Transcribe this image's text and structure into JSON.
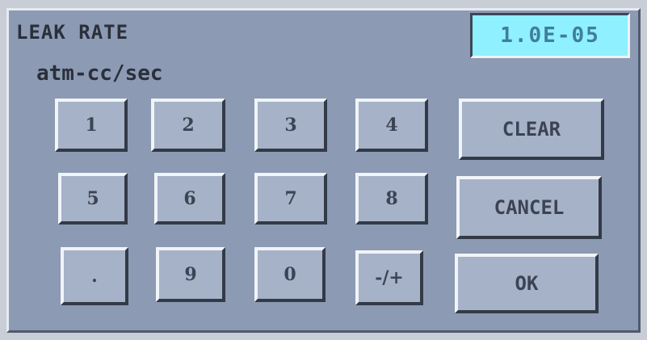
{
  "screen": {
    "title": "LEAK RATE",
    "units": "atm-cc/sec",
    "display_value": "1.0E-05"
  },
  "keypad": {
    "rows": [
      [
        "1",
        "2",
        "3",
        "4",
        "CLEAR"
      ],
      [
        "5",
        "6",
        "7",
        "8",
        "CANCEL"
      ],
      [
        ".",
        "9",
        "0",
        "-/+",
        "OK"
      ]
    ]
  },
  "colors": {
    "panel": "#8c9ab4",
    "key_face": "#a6b2c8",
    "display_background": "#8ff0ff",
    "display_text": "#3f7f99",
    "text": "#2a2f3a"
  }
}
